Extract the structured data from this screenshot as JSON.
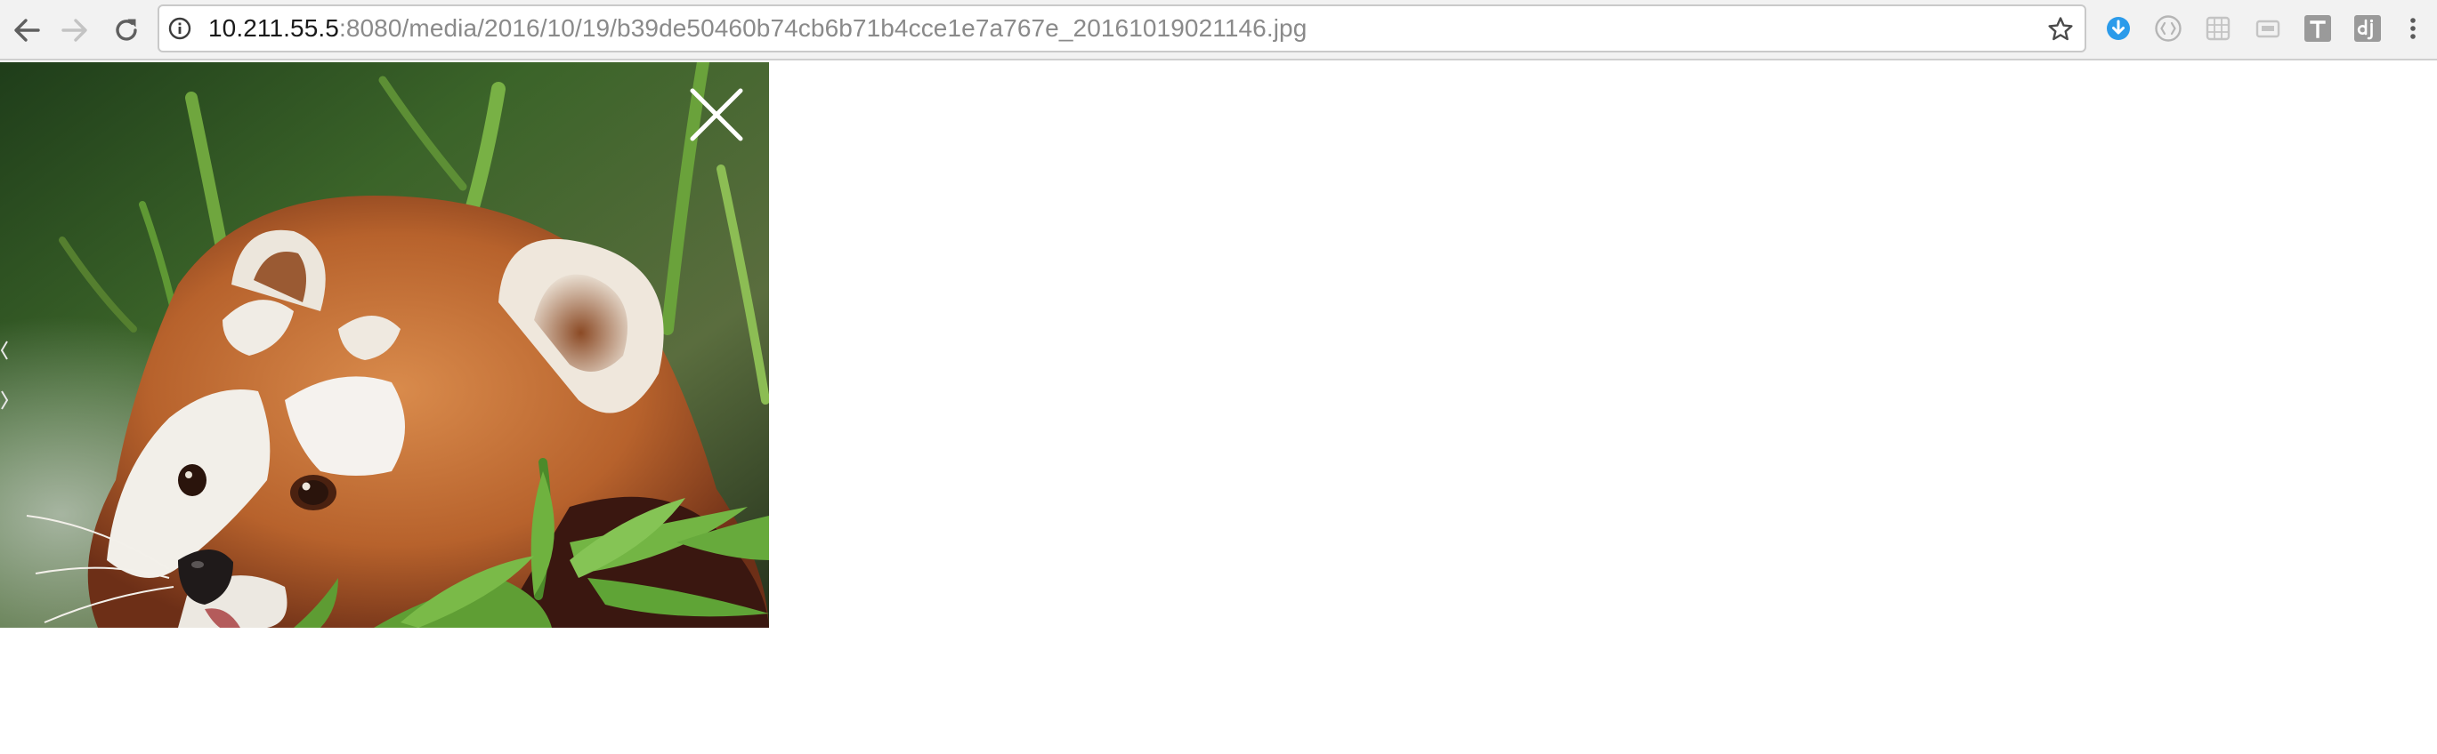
{
  "browser": {
    "url_host": "10.211.55.5",
    "url_rest": ":8080/media/2016/10/19/b39de50460b74cb6b71b4cce1e7a767e_20161019021146.jpg",
    "nav": {
      "back_icon": "back-arrow-icon",
      "forward_icon": "forward-arrow-icon",
      "reload_icon": "reload-icon"
    },
    "extensions": [
      {
        "name": "download-icon",
        "color": "#2b9bea"
      },
      {
        "name": "code-brackets-icon",
        "color": "#b5b5b5"
      },
      {
        "name": "grid-icon",
        "color": "#c4c4c4"
      },
      {
        "name": "window-icon",
        "color": "#c4c4c4"
      },
      {
        "name": "text-t-icon",
        "label": "T",
        "color": "#9a9a9a"
      },
      {
        "name": "dj-icon",
        "label": "dj",
        "color": "#9a9a9a"
      },
      {
        "name": "more-menu-icon",
        "color": "#5a5a5a"
      }
    ]
  },
  "viewer": {
    "image_subject": "red-panda-eating-bamboo",
    "close_icon": "close-icon"
  }
}
